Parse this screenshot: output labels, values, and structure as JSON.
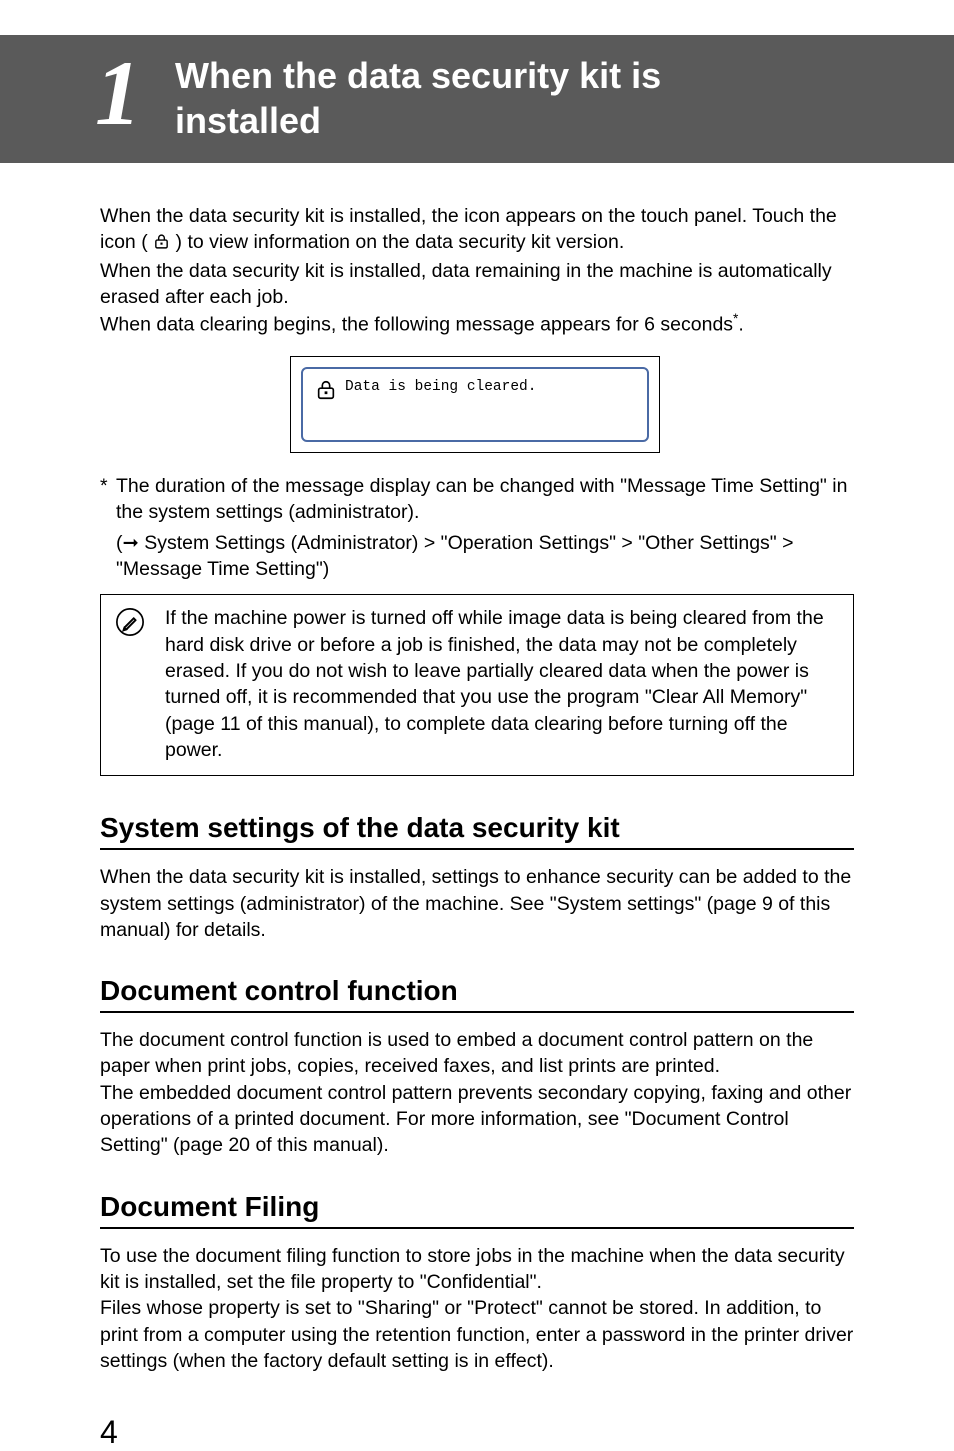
{
  "chapter": {
    "number": "1",
    "title_line1": "When the data security kit is",
    "title_line2": "installed"
  },
  "intro": {
    "p1a": "When the data security kit is installed, the icon appears on the touch panel. Touch the icon (",
    "p1b": ") to view information on the data security kit version.",
    "p2": "When the data security kit is installed, data remaining in the machine is automatically erased after each job.",
    "p3a": "When data clearing begins, the following message appears for 6 seconds",
    "p3b": "."
  },
  "clearing_message": "Data is being cleared.",
  "footnote": {
    "mark": "*",
    "text": "The duration of the message display can be changed with \"Message Time Setting\" in the system settings (administrator).",
    "sub_prefix": "(",
    "sub_arrow": "➞",
    "sub_text": " System Settings (Administrator) > \"Operation Settings\" > \"Other Settings\" > \"Message Time Setting\")"
  },
  "note": "If the machine power is turned off while image data is being cleared from the hard disk drive or before a job is finished, the data may not be completely erased. If you do not wish to leave partially cleared data when the power is turned off, it is recommended that you use the program \"Clear All Memory\" (page 11 of this manual), to complete data clearing before turning off the power.",
  "sections": {
    "s1": {
      "heading": "System settings of the data security kit",
      "body": "When the data security kit is installed, settings to enhance security can be added to the system settings (administrator) of the machine. See \"System settings\" (page 9 of this manual) for details."
    },
    "s2": {
      "heading": "Document control function",
      "body1": "The document control function is used to embed a document control pattern on the paper when print jobs, copies, received faxes, and list prints are printed.",
      "body2": "The embedded document control pattern prevents secondary copying, faxing and other operations of a printed document. For more information, see \"Document Control Setting\" (page 20 of this manual)."
    },
    "s3": {
      "heading": "Document Filing",
      "body1": "To use the document filing function to store jobs in the machine when the data security kit is installed, set the file property to \"Confidential\".",
      "body2": "Files whose property is set to \"Sharing\" or \"Protect\" cannot be stored. In addition, to print from a computer using the retention function, enter a password in the printer driver settings (when the factory default setting is in effect)."
    }
  },
  "page_number": "4",
  "icons": {
    "touch_lock": "touch-lock-icon",
    "clearing_lock": "clearing-lock-icon",
    "note": "note-pencil-icon"
  }
}
